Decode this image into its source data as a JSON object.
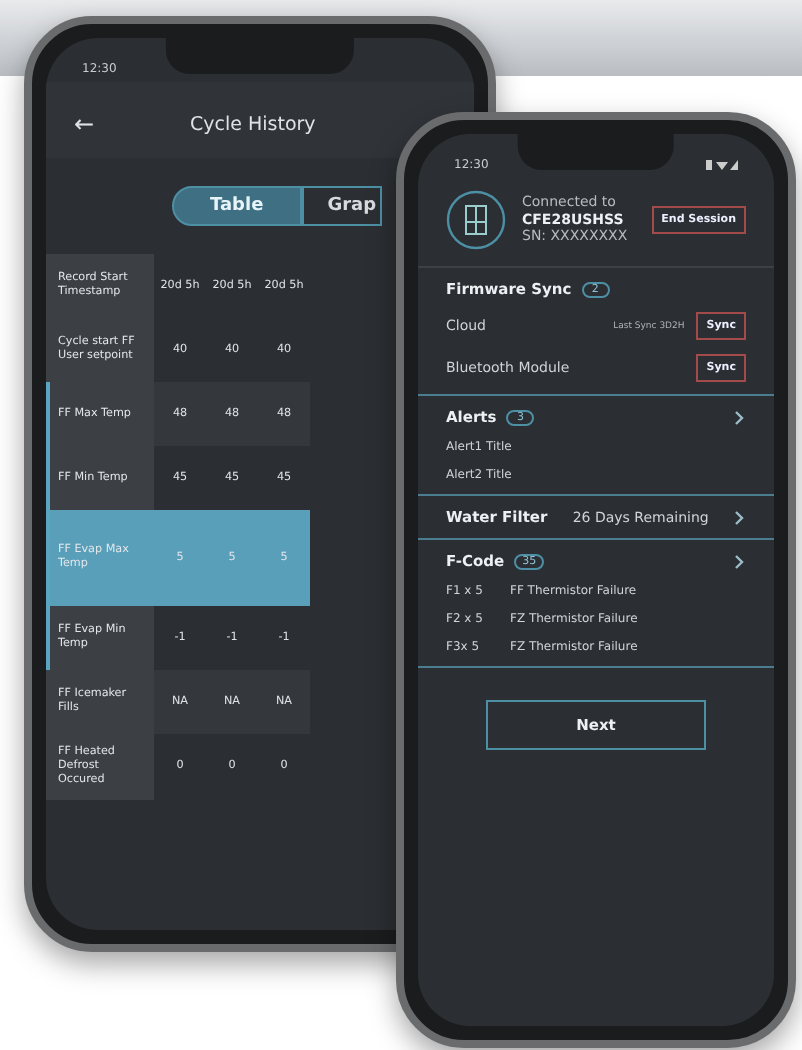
{
  "history_phone": {
    "status_time": "12:30",
    "title": "Cycle History",
    "back_icon": "←",
    "tabs": [
      {
        "label": "Table",
        "selected": true
      },
      {
        "label": "Grap",
        "selected": false
      }
    ],
    "header": {
      "label": "Record Start Timestamp",
      "values": [
        "20d 5h",
        "20d 5h",
        "20d 5h"
      ]
    },
    "rows": [
      {
        "label": "Cycle start FF User setpoint",
        "values": [
          "40",
          "40",
          "40"
        ],
        "selected": false
      },
      {
        "label": "FF Max Temp",
        "values": [
          "48",
          "48",
          "48"
        ],
        "selected": false
      },
      {
        "label": "FF Min Temp",
        "values": [
          "45",
          "45",
          "45"
        ],
        "selected": false
      },
      {
        "label": "FF Evap Max Temp",
        "values": [
          "5",
          "5",
          "5"
        ],
        "selected": true
      },
      {
        "label": "FF Evap Min Temp",
        "values": [
          "-1",
          "-1",
          "-1"
        ],
        "selected": false
      },
      {
        "label": "FF Icemaker Fills",
        "values": [
          "NA",
          "NA",
          "NA"
        ],
        "selected": false
      },
      {
        "label": "FF Heated Defrost Occured",
        "values": [
          "0",
          "0",
          "0"
        ],
        "selected": false
      }
    ]
  },
  "session_phone": {
    "status_time": "12:30",
    "connected_label": "Connected to",
    "model": "CFE28USHSS",
    "serial": "SN: XXXXXXXX",
    "end_button": "End Session",
    "firmware": {
      "title": "Firmware Sync",
      "count": "2",
      "items": [
        {
          "name": "Cloud",
          "note": "Last Sync 3D2H",
          "button": "Sync"
        },
        {
          "name": "Bluetooth Module",
          "button": "Sync"
        }
      ]
    },
    "alerts": {
      "title": "Alerts",
      "count": "3",
      "items": [
        "Alert1 Title",
        "Alert2 Title"
      ]
    },
    "water_filter": {
      "title": "Water Filter",
      "value": "26 Days Remaining"
    },
    "fcode": {
      "title": "F-Code",
      "count": "35",
      "items": [
        {
          "code": "F1 x 5",
          "text": "FF Thermistor Failure"
        },
        {
          "code": "F2 x 5",
          "text": "FZ Thermistor Failure"
        },
        {
          "code": "F3x 5",
          "text": "FZ Thermistor Failure"
        }
      ]
    },
    "next_button": "Next"
  }
}
